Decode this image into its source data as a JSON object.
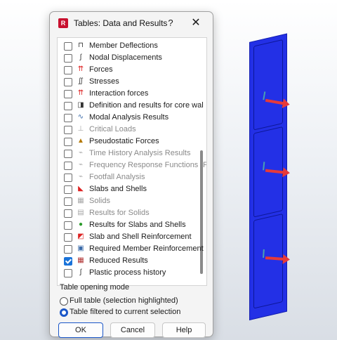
{
  "dialog": {
    "title": "Tables: Data and Results",
    "help_symbol": "?",
    "close_symbol": "✕",
    "app_icon_letter": "R"
  },
  "list": {
    "items": [
      {
        "label": "Member Deflections",
        "icon": "member-deflections-icon",
        "checked": false,
        "disabled": false
      },
      {
        "label": "Nodal Displacements",
        "icon": "nodal-displacements-icon",
        "checked": false,
        "disabled": false
      },
      {
        "label": "Forces",
        "icon": "forces-icon",
        "checked": false,
        "disabled": false
      },
      {
        "label": "Stresses",
        "icon": "stresses-icon",
        "checked": false,
        "disabled": false
      },
      {
        "label": "Interaction forces",
        "icon": "interaction-forces-icon",
        "checked": false,
        "disabled": false
      },
      {
        "label": "Definition and results for core wal",
        "icon": "core-wall-icon",
        "checked": false,
        "disabled": false
      },
      {
        "label": "Modal Analysis Results",
        "icon": "modal-analysis-icon",
        "checked": false,
        "disabled": false
      },
      {
        "label": "Critical Loads",
        "icon": "critical-loads-icon",
        "checked": false,
        "disabled": true
      },
      {
        "label": "Pseudostatic Forces",
        "icon": "pseudostatic-forces-icon",
        "checked": false,
        "disabled": false
      },
      {
        "label": "Time History Analysis Results",
        "icon": "time-history-icon",
        "checked": false,
        "disabled": true
      },
      {
        "label": "Frequency Response Functions (F",
        "icon": "frequency-response-icon",
        "checked": false,
        "disabled": true
      },
      {
        "label": "Footfall Analysis",
        "icon": "footfall-analysis-icon",
        "checked": false,
        "disabled": true
      },
      {
        "label": "Slabs and Shells",
        "icon": "slabs-shells-icon",
        "checked": false,
        "disabled": false
      },
      {
        "label": "Solids",
        "icon": "solids-icon",
        "checked": false,
        "disabled": true
      },
      {
        "label": "Results for Solids",
        "icon": "results-solids-icon",
        "checked": false,
        "disabled": true
      },
      {
        "label": "Results for Slabs and Shells",
        "icon": "results-slabs-shells-icon",
        "checked": false,
        "disabled": false
      },
      {
        "label": "Slab and Shell Reinforcement",
        "icon": "slab-shell-reinforcement-icon",
        "checked": false,
        "disabled": false
      },
      {
        "label": "Required Member Reinforcement",
        "icon": "member-reinforcement-icon",
        "checked": false,
        "disabled": false
      },
      {
        "label": "Reduced Results",
        "icon": "reduced-results-icon",
        "checked": true,
        "disabled": false
      },
      {
        "label": "Plastic process history",
        "icon": "plastic-process-icon",
        "checked": false,
        "disabled": false
      }
    ]
  },
  "mode": {
    "title": "Table opening mode",
    "options": [
      {
        "label": "Full table (selection highlighted)",
        "selected": false
      },
      {
        "label": "Table filtered to current selection",
        "selected": true
      }
    ]
  },
  "buttons": {
    "ok": "OK",
    "cancel": "Cancel",
    "help": "Help"
  },
  "colors": {
    "accent": "#1a56c8",
    "wall": "#2330e6",
    "load_arrow": "#e63a3a"
  }
}
